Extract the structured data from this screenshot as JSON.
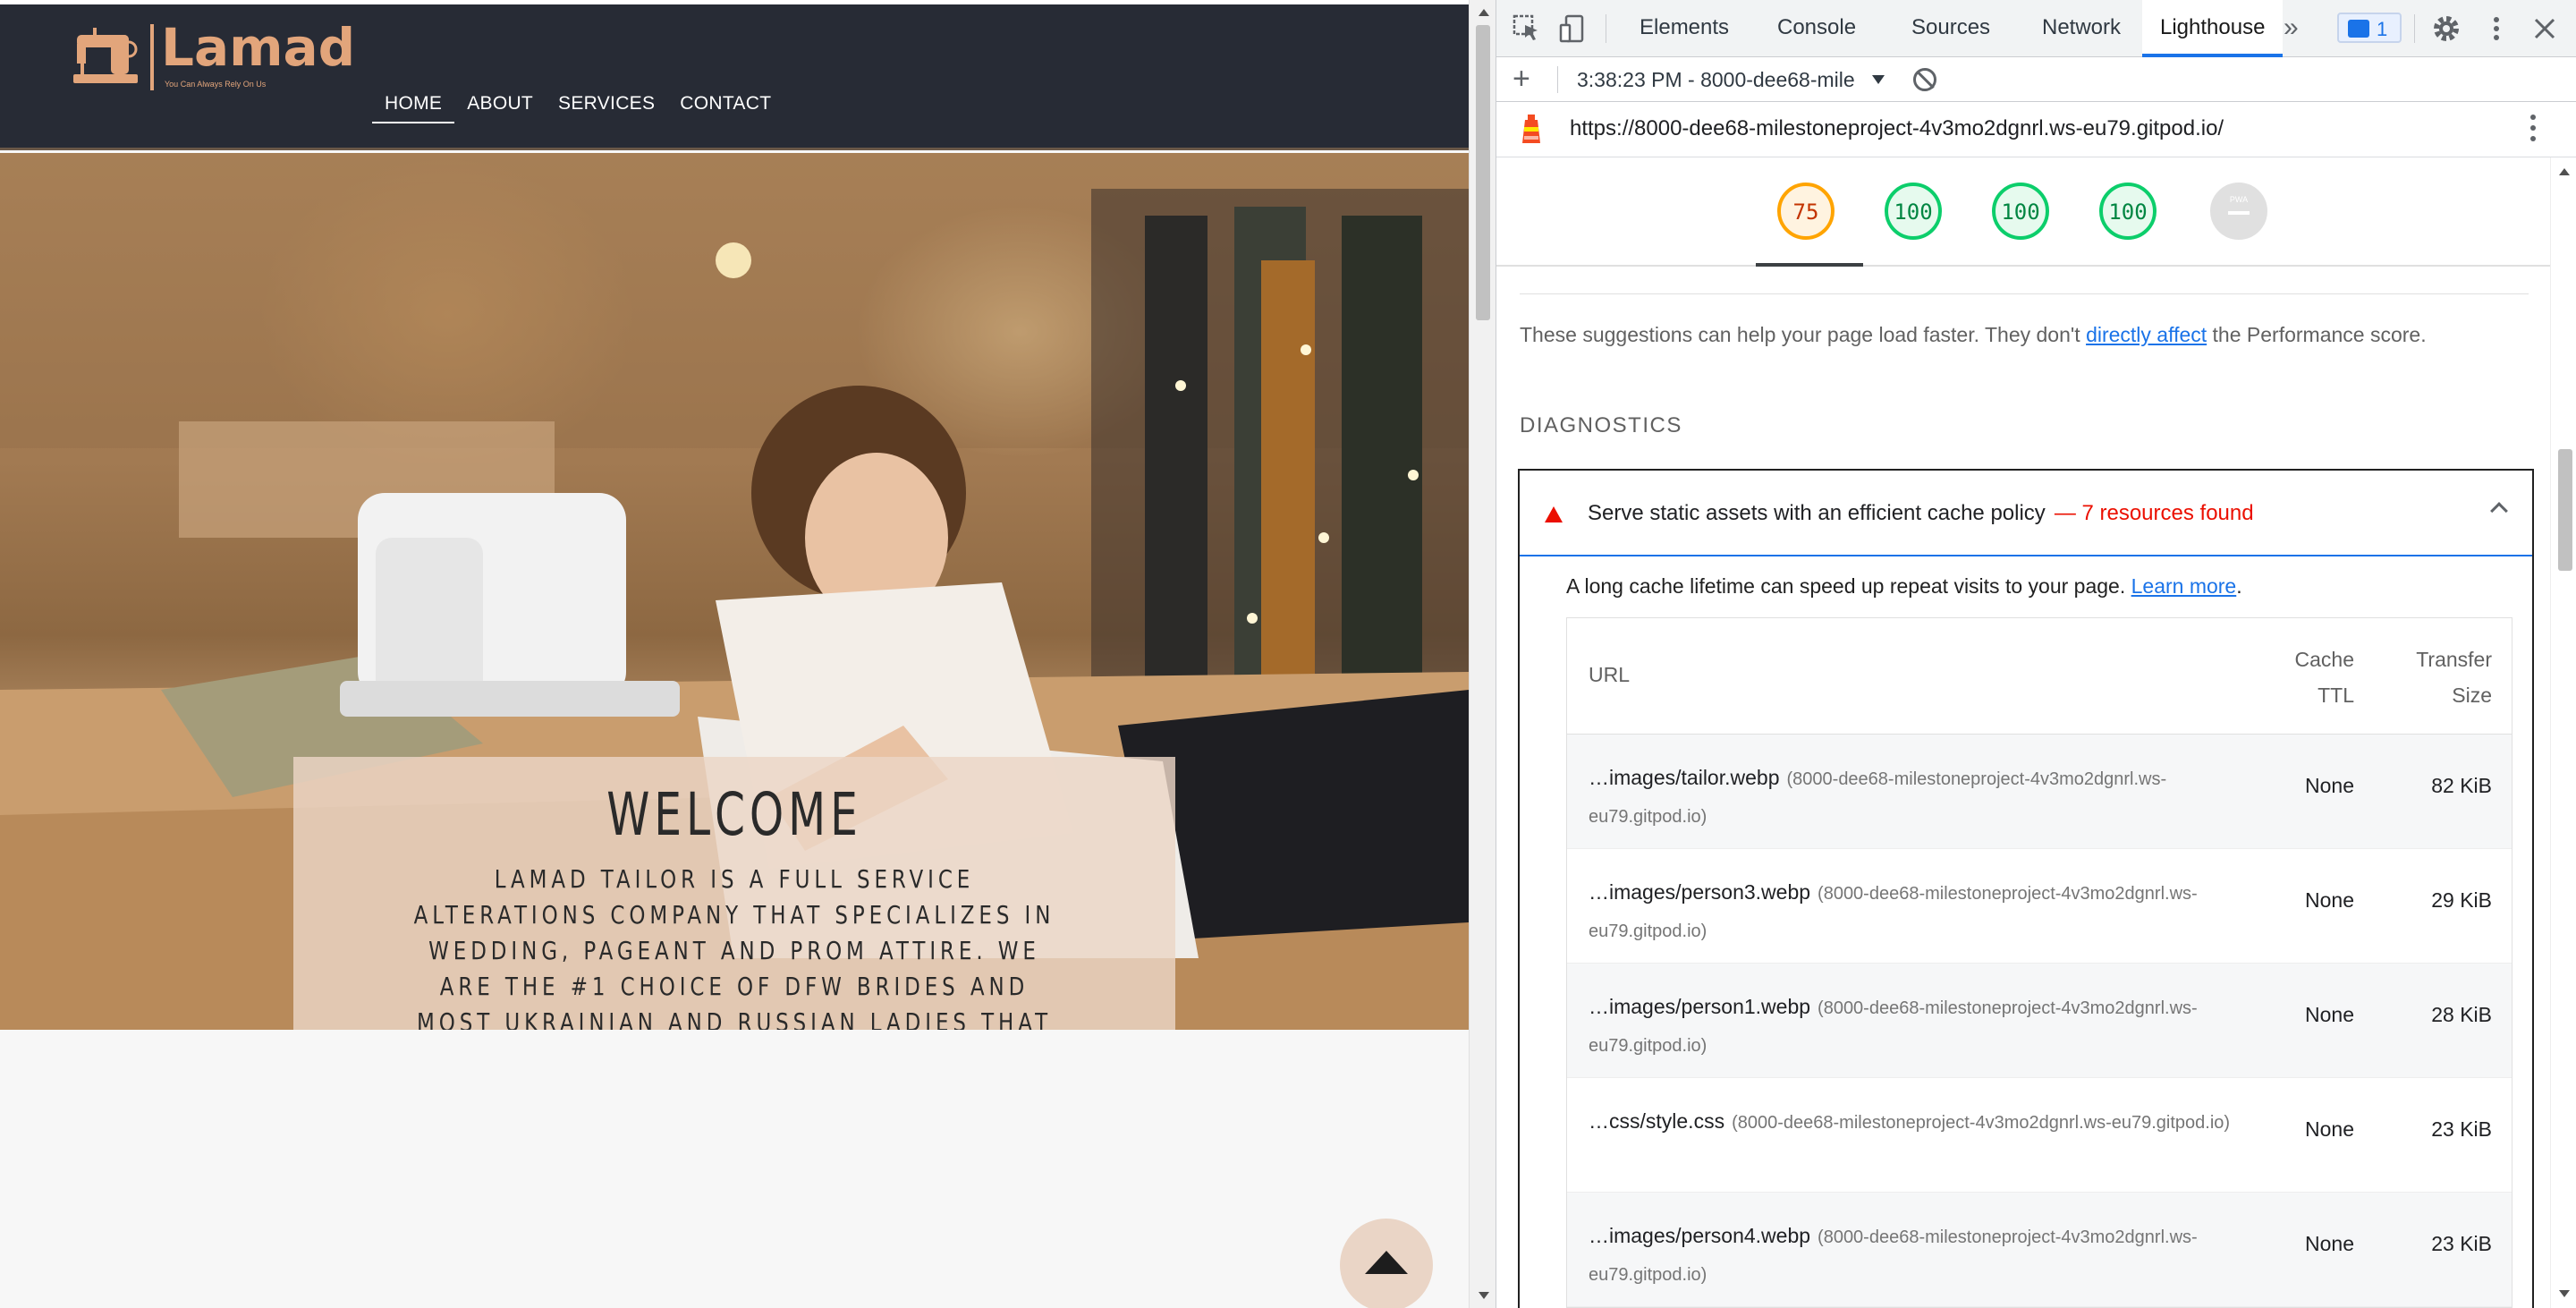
{
  "site": {
    "logo": {
      "brand": "Lamad",
      "tagline": "You Can Always Rely On Us"
    },
    "nav": [
      {
        "label": "HOME"
      },
      {
        "label": "ABOUT"
      },
      {
        "label": "SERVICES"
      },
      {
        "label": "CONTACT"
      }
    ],
    "hero": {
      "title": "WELCOME",
      "description": "Lamad Tailor is a full service alterations company that specializes in wedding, pageant and prom attire. We are the #1 choice of DFW brides and most Ukrainian and Russian ladies that flee their countries from the war."
    },
    "scroll_top_icon": "chevron-up-icon"
  },
  "devtools": {
    "tabs": [
      {
        "label": "Elements"
      },
      {
        "label": "Console"
      },
      {
        "label": "Sources"
      },
      {
        "label": "Network"
      },
      {
        "label": "Lighthouse"
      }
    ],
    "active_tab": "Lighthouse",
    "more_tabs_label": "»",
    "message_count": "1",
    "accent": "#1a73e8",
    "toolbar": {
      "add_label": "+",
      "session": "3:38:23 PM - 8000-dee68-mile"
    },
    "report_url": "https://8000-dee68-milestoneproject-4v3mo2dgnrl.ws-eu79.gitpod.io/",
    "gauges": [
      {
        "score": "75",
        "status": "average",
        "color": "#ffa400"
      },
      {
        "score": "100",
        "status": "pass",
        "color": "#0cce6b"
      },
      {
        "score": "100",
        "status": "pass",
        "color": "#0cce6b"
      },
      {
        "score": "100",
        "status": "pass",
        "color": "#0cce6b"
      },
      {
        "score": "",
        "label": "PWA",
        "status": "not-applicable",
        "color": "#e0e0e0"
      }
    ],
    "suggestions": {
      "before": "These suggestions can help your page load faster. They don't ",
      "link": "directly affect",
      "after": " the Performance score."
    },
    "diagnostics_title": "DIAGNOSTICS",
    "audit": {
      "title": "Serve static assets with an efficient cache policy",
      "count": "— 7 resources found",
      "description": "A long cache lifetime can speed up repeat visits to your page.",
      "learn_more": "Learn more",
      "columns": {
        "url": "URL",
        "ttl": "Cache TTL",
        "size": "Transfer Size"
      },
      "rows": [
        {
          "path": "…images/tailor.webp",
          "source": "(8000-dee68-milestoneproject-4v3mo2dgnrl.ws-eu79.gitpod.io)",
          "ttl": "None",
          "size": "82 KiB"
        },
        {
          "path": "…images/person3.webp",
          "source": "(8000-dee68-milestoneproject-4v3mo2dgnrl.ws-eu79.gitpod.io)",
          "ttl": "None",
          "size": "29 KiB"
        },
        {
          "path": "…images/person1.webp",
          "source": "(8000-dee68-milestoneproject-4v3mo2dgnrl.ws-eu79.gitpod.io)",
          "ttl": "None",
          "size": "28 KiB"
        },
        {
          "path": "…css/style.css",
          "source": "(8000-dee68-milestoneproject-4v3mo2dgnrl.ws-eu79.gitpod.io)",
          "ttl": "None",
          "size": "23 KiB"
        },
        {
          "path": "…images/person4.webp",
          "source": "(8000-dee68-milestoneproject-4v3mo2dgnrl.ws-eu79.gitpod.io)",
          "ttl": "None",
          "size": "23 KiB"
        }
      ]
    }
  }
}
